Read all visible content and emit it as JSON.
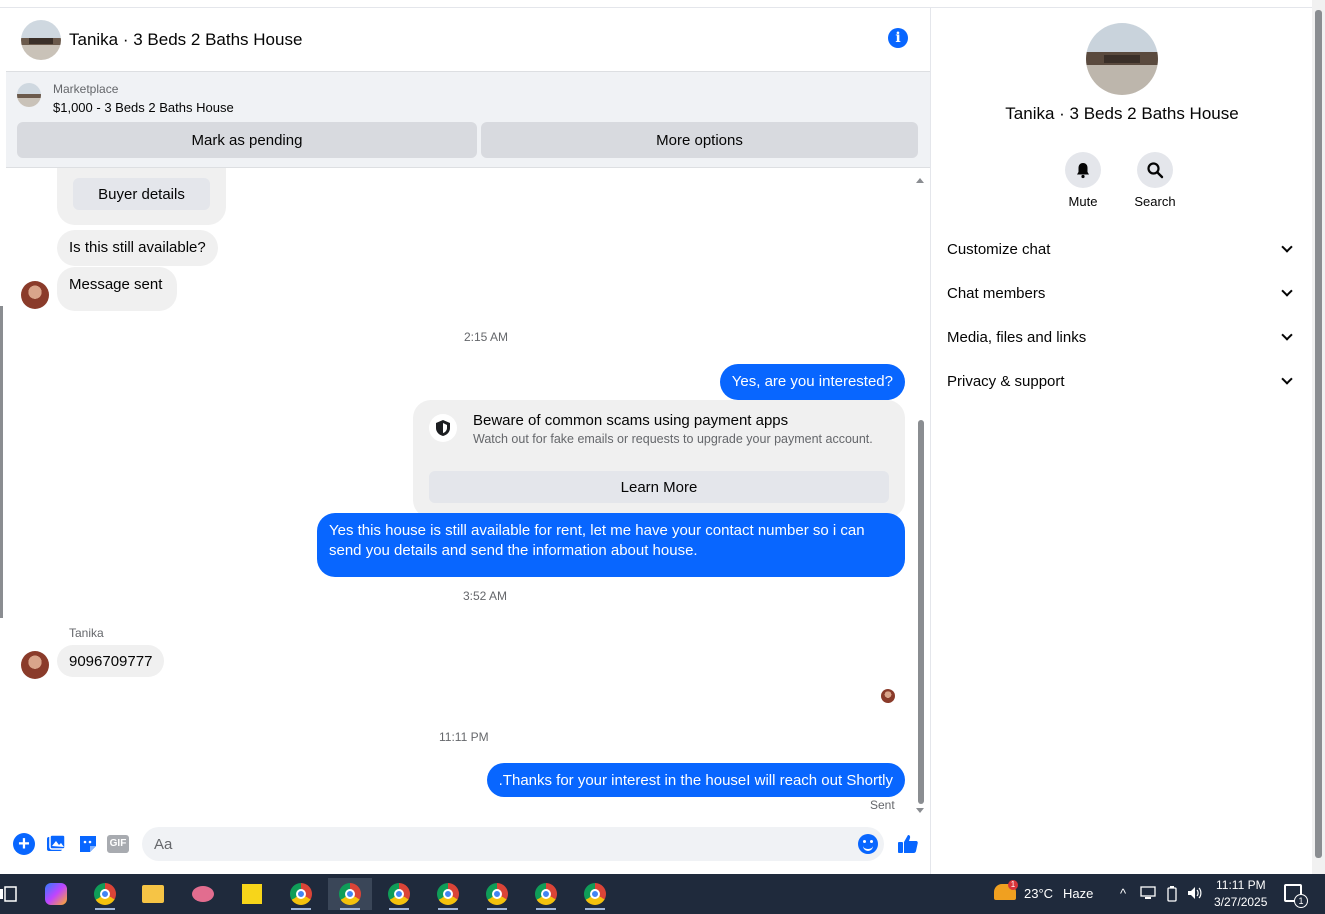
{
  "chat": {
    "title": "Tanika · 3 Beds 2 Baths House",
    "marketplace": {
      "label": "Marketplace",
      "item": "$1,000 - 3 Beds 2 Baths House",
      "mark_pending": "Mark as pending",
      "more_options": "More options"
    },
    "buyer_details": "Buyer details",
    "messages": {
      "m1": "Is this still available?",
      "m2": "Message sent",
      "t1": "2:15 AM",
      "m3": "Yes, are you interested?",
      "m5": "Yes this house is still available for rent, let me have your contact number so i can send you details and send the information about house.",
      "t2": "3:52 AM",
      "sender": "Tanika",
      "m6": "9096709777",
      "t3": "11:11 PM",
      "m7": ".Thanks for your interest in the houseI will reach out Shortly",
      "status": "Sent"
    },
    "scam_notice": {
      "title": "Beware of common scams using payment apps",
      "subtitle": "Watch out for fake emails or requests to upgrade your payment account.",
      "button": "Learn More"
    },
    "composer": {
      "placeholder": "Aa",
      "gif": "GIF"
    }
  },
  "panel": {
    "title": "Tanika · 3 Beds 2 Baths House",
    "actions": {
      "mute": "Mute",
      "search": "Search"
    },
    "sections": [
      "Customize chat",
      "Chat members",
      "Media, files and links",
      "Privacy & support"
    ]
  },
  "taskbar": {
    "weather": {
      "temp": "23°C",
      "condition": "Haze",
      "badge": "1"
    },
    "time": "11:11 PM",
    "date": "3/27/2025",
    "notifications": "1"
  },
  "colors": {
    "accent": "#0866ff",
    "bubble_in": "#f0f0f0",
    "taskbar": "#1f2a3c"
  }
}
